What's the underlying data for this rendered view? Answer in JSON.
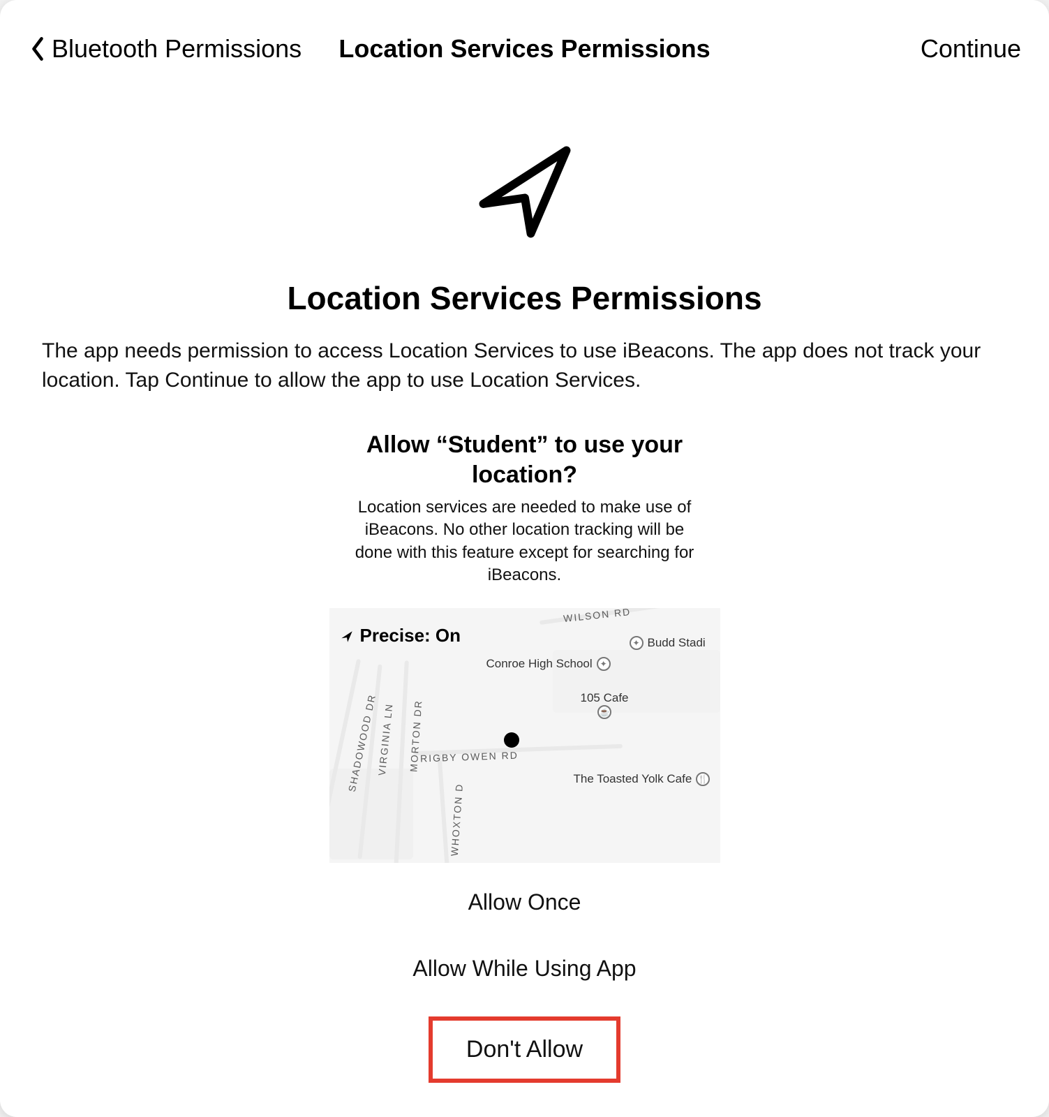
{
  "nav": {
    "back_label": "Bluetooth Permissions",
    "title": "Location Services Permissions",
    "continue_label": "Continue"
  },
  "hero": {
    "title": "Location Services Permissions",
    "description": "The app needs permission to access Location Services to use iBeacons. The app does not track your location. Tap Continue to allow the app to use Location Services."
  },
  "alert": {
    "title": "Allow “Student” to use your location?",
    "body": "Location services are needed to make use of iBeacons. No other location tracking will be done with this feature except for searching for iBeacons.",
    "precise_label": "Precise: On"
  },
  "map": {
    "roads": {
      "wilson": "WILSON RD",
      "rigby": "RIGBY OWEN RD",
      "shadowood": "SHADOWOOD DR",
      "virginia": "VIRGINIA LN",
      "morton": "MORTON DR",
      "whoxton": "WHOXTON D"
    },
    "pois": {
      "conroe": "Conroe High School",
      "budd": "Budd Stadi",
      "cafe105": "105 Cafe",
      "toasted": "The Toasted Yolk Cafe"
    }
  },
  "options": {
    "allow_once": "Allow Once",
    "allow_while": "Allow While Using App",
    "dont_allow": "Don't Allow"
  }
}
